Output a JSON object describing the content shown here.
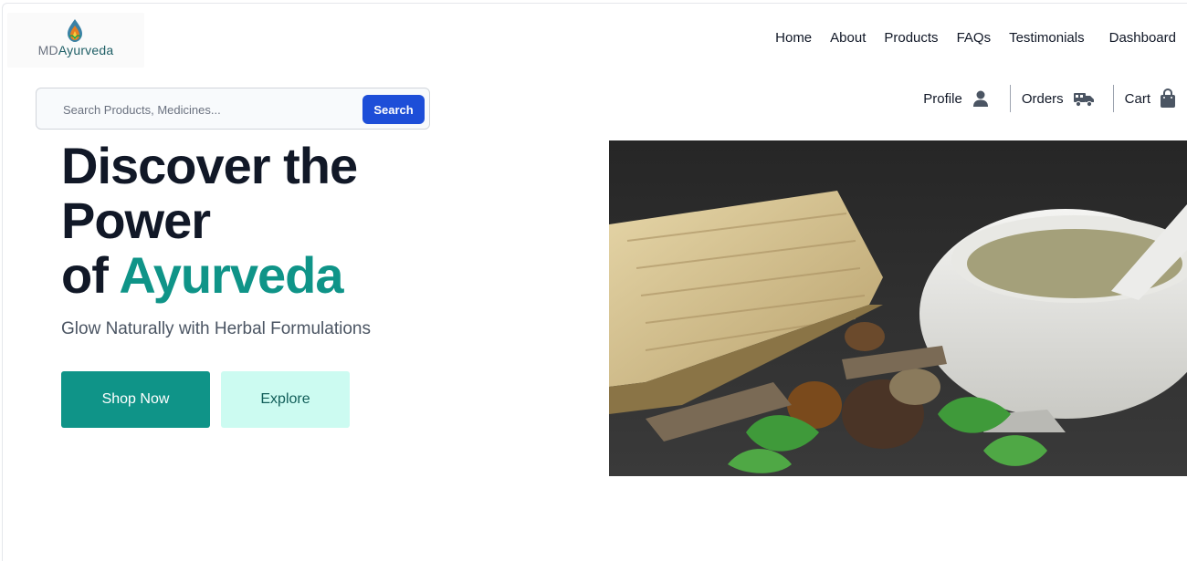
{
  "brand": {
    "prefix": "MD",
    "name": "Ayurveda"
  },
  "nav": {
    "items": [
      "Home",
      "About",
      "Products",
      "FAQs",
      "Testimonials"
    ],
    "dashboard": "Dashboard"
  },
  "search": {
    "placeholder": "Search Products, Medicines...",
    "button": "Search"
  },
  "user_nav": {
    "profile": "Profile",
    "orders": "Orders",
    "cart": "Cart"
  },
  "hero": {
    "line1": "Discover the",
    "line2": "Power",
    "line3_prefix": "of",
    "line3_highlight": "Ayurveda",
    "subtitle": "Glow Naturally with Herbal Formulations",
    "primary_button": "Shop Now",
    "secondary_button": "Explore"
  },
  "colors": {
    "accent": "#0f9488",
    "accent_light": "#ccfbf1",
    "search_button": "#1d4ed8",
    "heading": "#111827"
  },
  "icons": {
    "profile": "user-icon",
    "orders": "truck-icon",
    "cart": "shopping-bag-icon"
  }
}
